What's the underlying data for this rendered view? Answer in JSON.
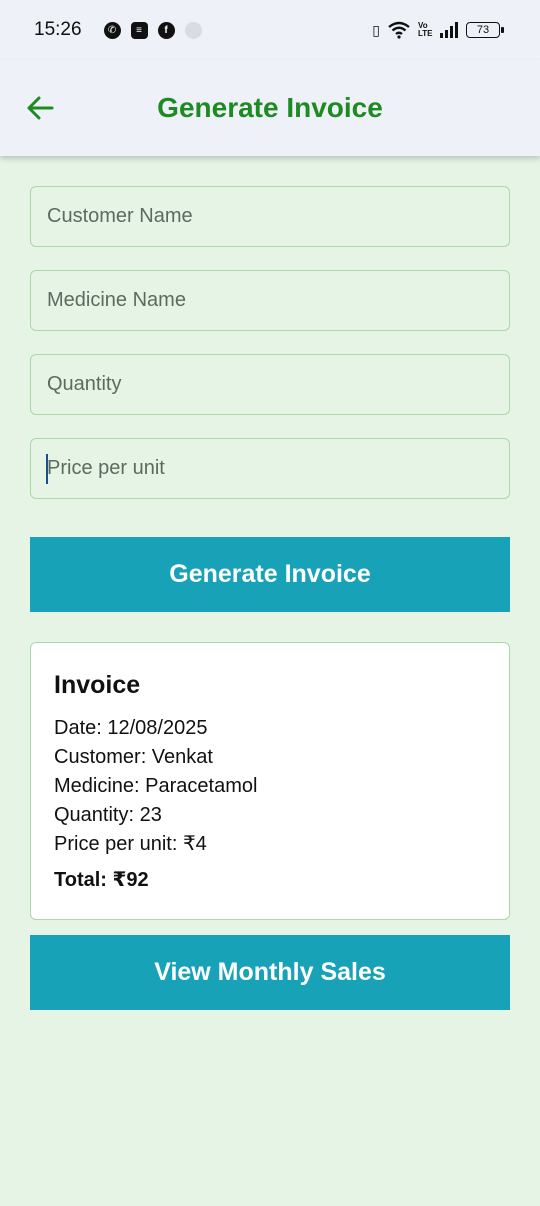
{
  "status_bar": {
    "time": "15:26",
    "battery": "73",
    "volte": "Vo LTE"
  },
  "app_bar": {
    "title": "Generate Invoice"
  },
  "form": {
    "customer_name_placeholder": "Customer Name",
    "medicine_name_placeholder": "Medicine Name",
    "quantity_placeholder": "Quantity",
    "price_placeholder": "Price per unit",
    "generate_button": "Generate Invoice"
  },
  "invoice": {
    "title": "Invoice",
    "date": "Date: 12/08/2025",
    "customer": "Customer: Venkat",
    "medicine": "Medicine: Paracetamol",
    "quantity": "Quantity: 23",
    "price": "Price per unit: ₹4",
    "total": "Total: ₹92"
  },
  "monthly_sales_button": "View Monthly Sales",
  "colors": {
    "accent": "#18a2b8",
    "title_green": "#1e8a22",
    "background": "#e6f4e6"
  }
}
